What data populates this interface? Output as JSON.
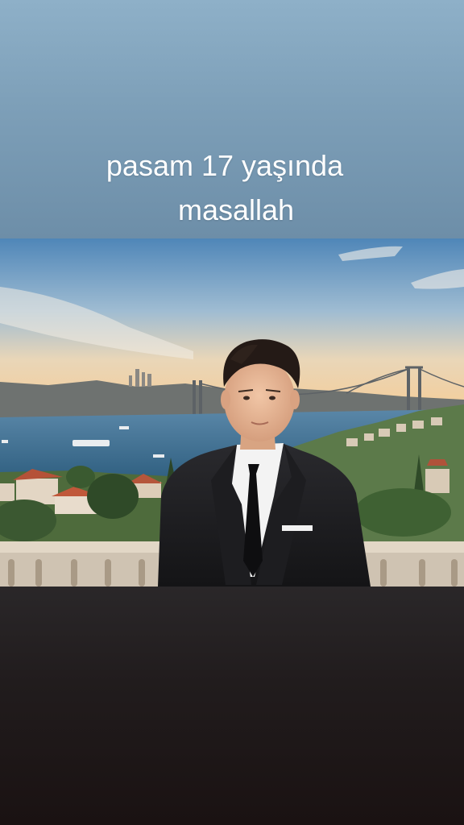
{
  "story": {
    "caption_line1": "pasam 17 yaşında",
    "caption_line2": "masallah"
  },
  "colors": {
    "top_background": "#7d9fb8",
    "bottom_background": "#1f1a1b",
    "caption_text": "#ffffff"
  }
}
